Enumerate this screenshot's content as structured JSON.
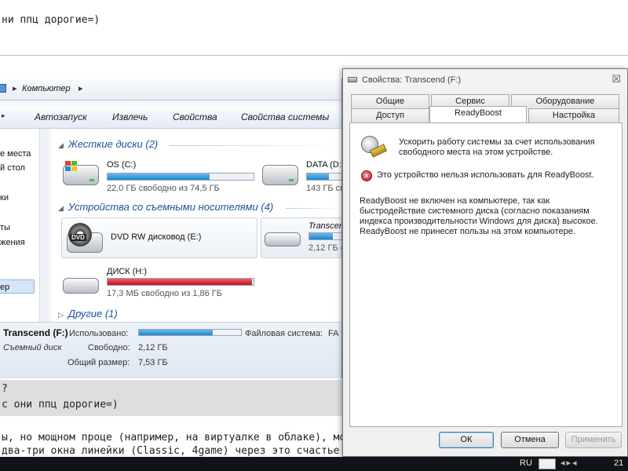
{
  "forum": {
    "top_line": "ни ппц дорогие=)",
    "quote_marker": "?",
    "quote_line": "с они ппц дорогие=)",
    "reply_line1": "ы, но мощном проце (например, на виртуалке в облаке), можн",
    "reply_line2": "два-три окна линейки (Classic, 4game) через это счастье подк"
  },
  "explorer": {
    "address": {
      "separator": "▸",
      "crumb": "Компьютер",
      "separator2": "▸"
    },
    "toolbar": {
      "arrow": "▸",
      "buttons": [
        "Автозапуск",
        "Извлечь",
        "Свойства",
        "Свойства системы"
      ]
    },
    "nav_items": [
      "е места",
      "й стол",
      "ки",
      "ты",
      "жения",
      "ер"
    ],
    "groups": {
      "hard_disks": {
        "arrow": "◢",
        "title": "Жесткие диски (2)"
      },
      "removable": {
        "arrow": "◢",
        "title": "Устройства со съемными носителями (4)"
      },
      "other": {
        "arrow": "▷",
        "title": "Другие (1)"
      }
    },
    "drives": {
      "c": {
        "name": "OS (C:)",
        "free": "22,0 ГБ свободно из 74,5 ГБ",
        "used_fraction": 0.7
      },
      "d": {
        "name": "DATA (D:",
        "free": "143 ГБ свобо",
        "used_fraction": 0.6
      },
      "e": {
        "name": "DVD RW дисковод (E:)",
        "badge": "DVD"
      },
      "f": {
        "name": "Transcen",
        "free": "2,12 ГБ с",
        "used_fraction": 0.72
      },
      "h": {
        "name": "ДИСК (H:)",
        "free": "17,3 МБ свободно из 1,86 ГБ",
        "used_fraction": 0.99
      }
    },
    "details": {
      "name": "Transcend (F:)",
      "type": "Съемный диск",
      "used_label": "Использовано:",
      "free_label": "Свободно:",
      "free_value": "2,12 ГБ",
      "total_label": "Общий размер:",
      "total_value": "7,53 ГБ",
      "fs_label": "Файловая система:",
      "fs_value": "FA",
      "used_fraction": 0.72
    }
  },
  "dialog": {
    "title": "Свойства: Transcend (F:)",
    "close": "☒",
    "tabs_row1": [
      "Общие",
      "Сервис",
      "Оборудование"
    ],
    "tabs_row2": [
      "Доступ",
      "ReadyBoost",
      "Настройка"
    ],
    "active_tab": "ReadyBoost",
    "intro": "Ускорить работу системы за счет использования свободного места на этом устройстве.",
    "error_glyph": "×",
    "error": "Это устройство нельзя использовать для ReadyBoost.",
    "explanation": "ReadyBoost не включен на компьютере, так как быстродействие системного диска (согласно показаниям индекса производительности Windows для диска) высокое. ReadyBoost не принесет пользы на этом компьютере.",
    "buttons": {
      "ok": "ОК",
      "cancel": "Отмена",
      "apply": "Применить"
    }
  },
  "taskbar": {
    "lang": "RU",
    "arrows": "◂▸◂",
    "clock": "21"
  }
}
